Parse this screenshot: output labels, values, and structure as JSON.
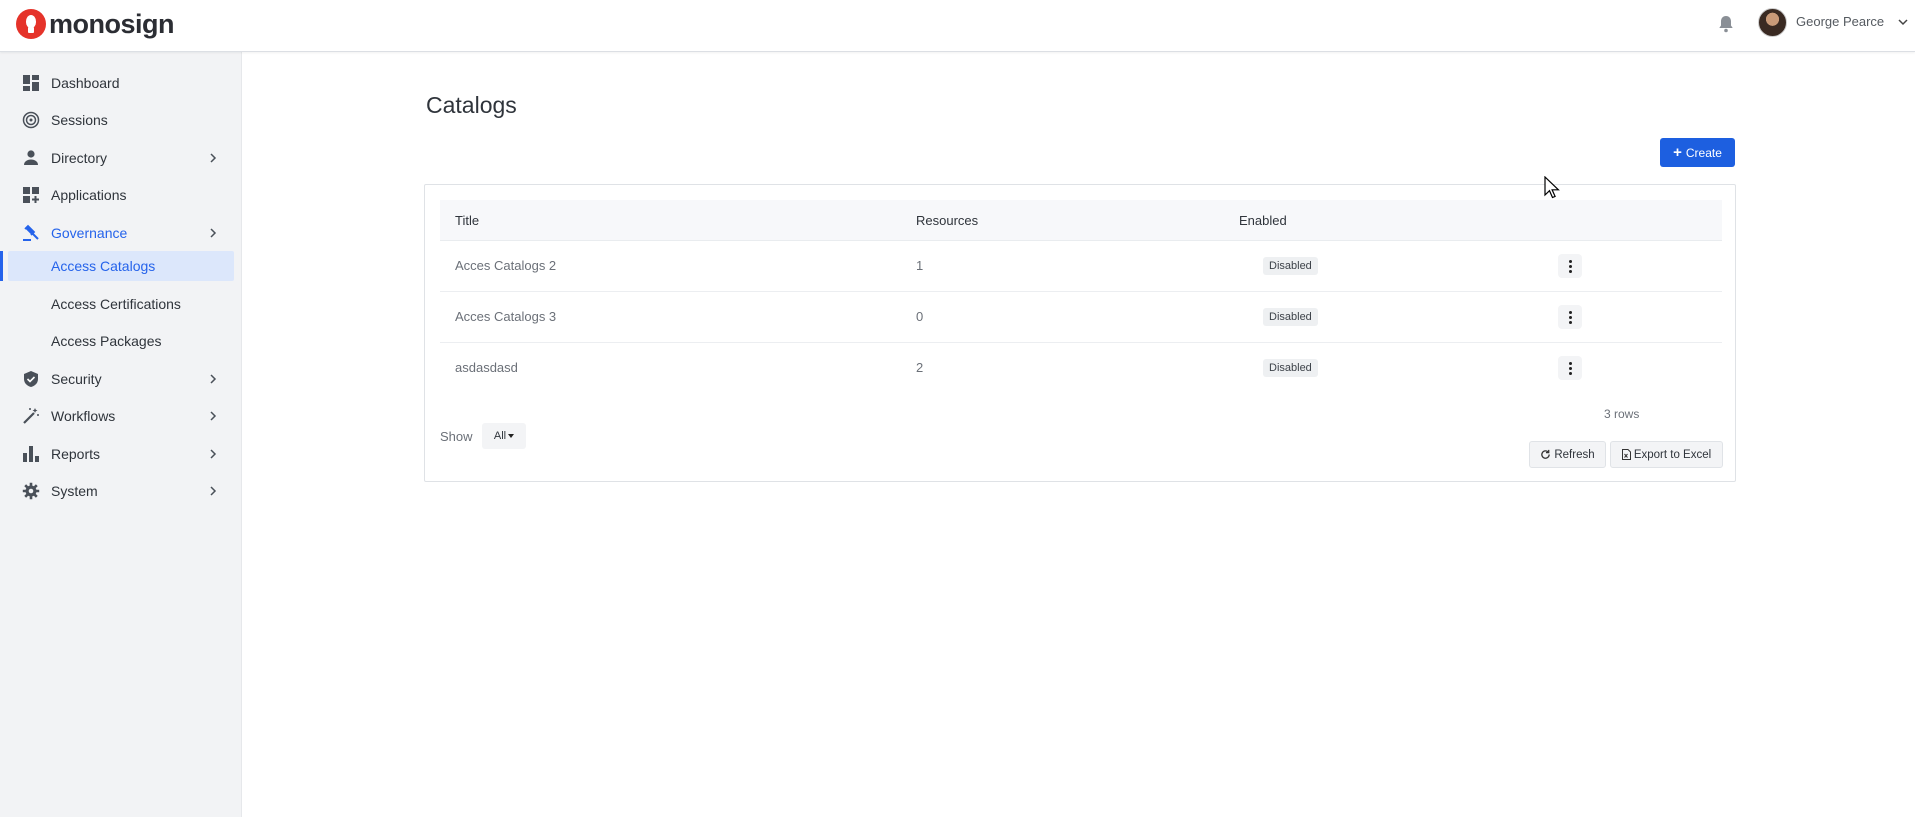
{
  "app": {
    "logo_text": "monosign",
    "user_name": "George Pearce",
    "brand_color": "#e5332a",
    "accent_color": "#1d5fe0"
  },
  "sidebar": {
    "items": [
      {
        "label": "Dashboard",
        "icon": "dashboard-icon",
        "has_chevron": false
      },
      {
        "label": "Sessions",
        "icon": "sessions-icon",
        "has_chevron": false
      },
      {
        "label": "Directory",
        "icon": "person-icon",
        "has_chevron": true
      },
      {
        "label": "Applications",
        "icon": "applications-icon",
        "has_chevron": false
      },
      {
        "label": "Governance",
        "icon": "gavel-icon",
        "has_chevron": true,
        "active": true
      },
      {
        "label": "Security",
        "icon": "shield-icon",
        "has_chevron": true
      },
      {
        "label": "Workflows",
        "icon": "wand-icon",
        "has_chevron": true
      },
      {
        "label": "Reports",
        "icon": "bar-chart-icon",
        "has_chevron": true
      },
      {
        "label": "System",
        "icon": "gear-icon",
        "has_chevron": true
      }
    ],
    "governance_sub": [
      {
        "label": "Access Catalogs",
        "active": true
      },
      {
        "label": "Access Certifications"
      },
      {
        "label": "Access Packages"
      }
    ]
  },
  "main": {
    "title": "Catalogs",
    "create_label": "Create",
    "table": {
      "columns": [
        "Title",
        "Resources",
        "Enabled"
      ],
      "rows": [
        {
          "title": "Acces Catalogs 2",
          "resources": "1",
          "enabled": "Disabled"
        },
        {
          "title": "Acces Catalogs 3",
          "resources": "0",
          "enabled": "Disabled"
        },
        {
          "title": "asdasdasd",
          "resources": "2",
          "enabled": "Disabled"
        }
      ]
    },
    "rows_count": "3 rows",
    "show_label": "Show",
    "show_value": "All",
    "refresh_label": "Refresh",
    "export_label": "Export to Excel"
  }
}
